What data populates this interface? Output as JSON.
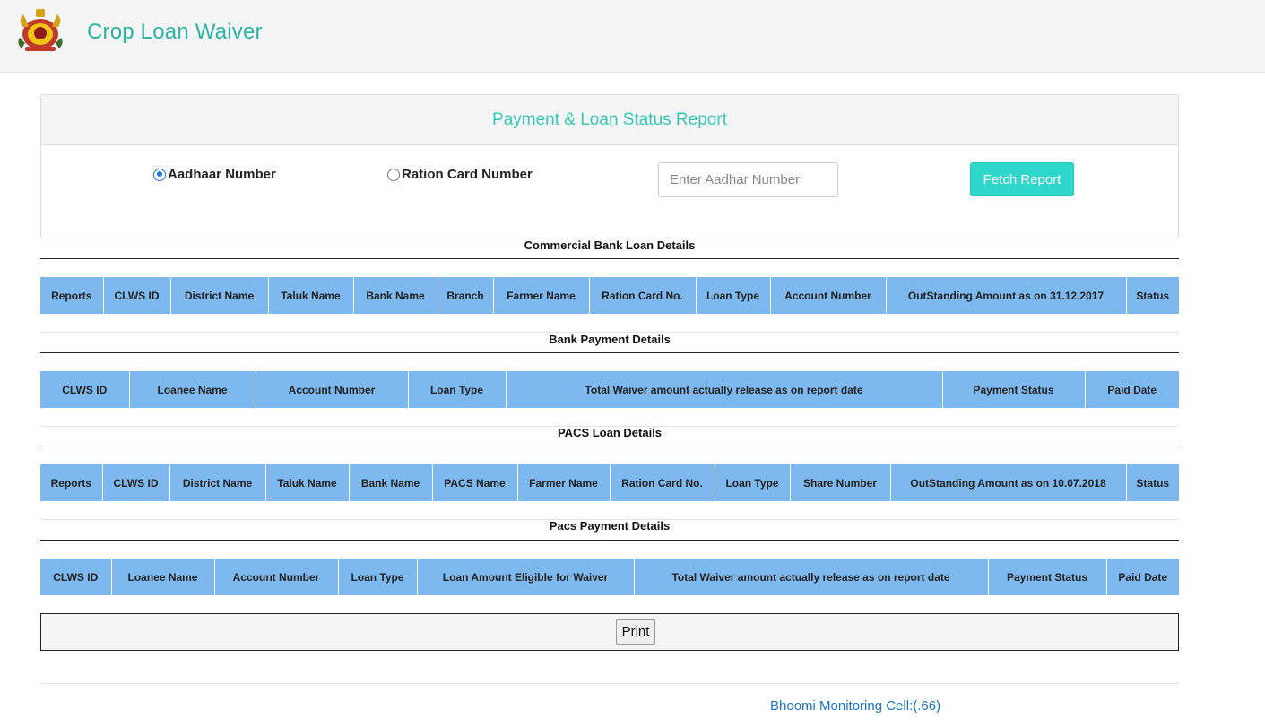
{
  "header": {
    "brand": "Crop Loan Waiver",
    "logo_icon": "karnataka-emblem-icon"
  },
  "search_panel": {
    "title": "Payment & Loan Status Report",
    "radio_aadhaar": "Aadhaar Number",
    "radio_ration": "Ration Card Number",
    "selected": "Aadhaar Number",
    "input_placeholder": "Enter Aadhar Number",
    "input_value": "",
    "fetch_button": "Fetch Report"
  },
  "sections": {
    "commercial_bank": {
      "title": "Commercial Bank Loan Details",
      "columns": [
        "Reports",
        "CLWS ID",
        "District Name",
        "Taluk Name",
        "Bank Name",
        "Branch",
        "Farmer Name",
        "Ration Card No.",
        "Loan Type",
        "Account Number",
        "OutStanding Amount as on 31.12.2017",
        "Status"
      ]
    },
    "bank_payment": {
      "title": "Bank Payment Details",
      "columns": [
        "CLWS ID",
        "Loanee Name",
        "Account Number",
        "Loan Type",
        "Total Waiver amount actually release as on report date",
        "Payment Status",
        "Paid Date"
      ]
    },
    "pacs_loan": {
      "title": "PACS Loan Details",
      "columns": [
        "Reports",
        "CLWS ID",
        "District Name",
        "Taluk Name",
        "Bank Name",
        "PACS Name",
        "Farmer Name",
        "Ration Card No.",
        "Loan Type",
        "Share Number",
        "OutStanding Amount as on 10.07.2018",
        "Status"
      ]
    },
    "pacs_payment": {
      "title": "Pacs Payment Details",
      "columns": [
        "CLWS ID",
        "Loanee Name",
        "Account Number",
        "Loan Type",
        "Loan Amount Eligible for Waiver",
        "Total Waiver amount actually release as on report date",
        "Payment Status",
        "Paid Date"
      ]
    }
  },
  "print_button": "Print",
  "footer": {
    "link": "Bhoomi Monitoring Cell:(.66)"
  },
  "colors": {
    "brand": "#2ab5a3",
    "accent": "#2fd6ca",
    "table_header": "#7db9ee",
    "link": "#1a73c8"
  }
}
